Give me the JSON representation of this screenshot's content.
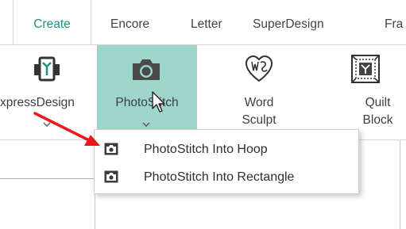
{
  "tabs": [
    {
      "label": "Create",
      "active": true
    },
    {
      "label": "Encore",
      "active": false
    },
    {
      "label": "Letter",
      "active": false
    },
    {
      "label": "SuperDesign",
      "active": false
    },
    {
      "label": "Fra",
      "active": false
    }
  ],
  "ribbon": {
    "express_design": {
      "label": "xpressDesign",
      "icon": "express-design-icon"
    },
    "photostitch": {
      "label": "PhotoStitch",
      "icon": "camera-icon"
    },
    "word_sculpt": {
      "label_line1": "Word",
      "label_line2": "Sculpt",
      "icon": "word-sculpt-heart-icon"
    },
    "quilt_block": {
      "label_line1": "Quilt",
      "label_line2": "Block",
      "icon": "quilt-block-icon"
    }
  },
  "menu": {
    "items": [
      {
        "label": "PhotoStitch Into Hoop",
        "icon": "camera-small-icon"
      },
      {
        "label": "PhotoStitch Into Rectangle",
        "icon": "camera-small-icon"
      }
    ]
  },
  "colors": {
    "accent": "#1f8f7e",
    "highlight": "#9fd6cc",
    "annotation_arrow": "#e8191d"
  }
}
